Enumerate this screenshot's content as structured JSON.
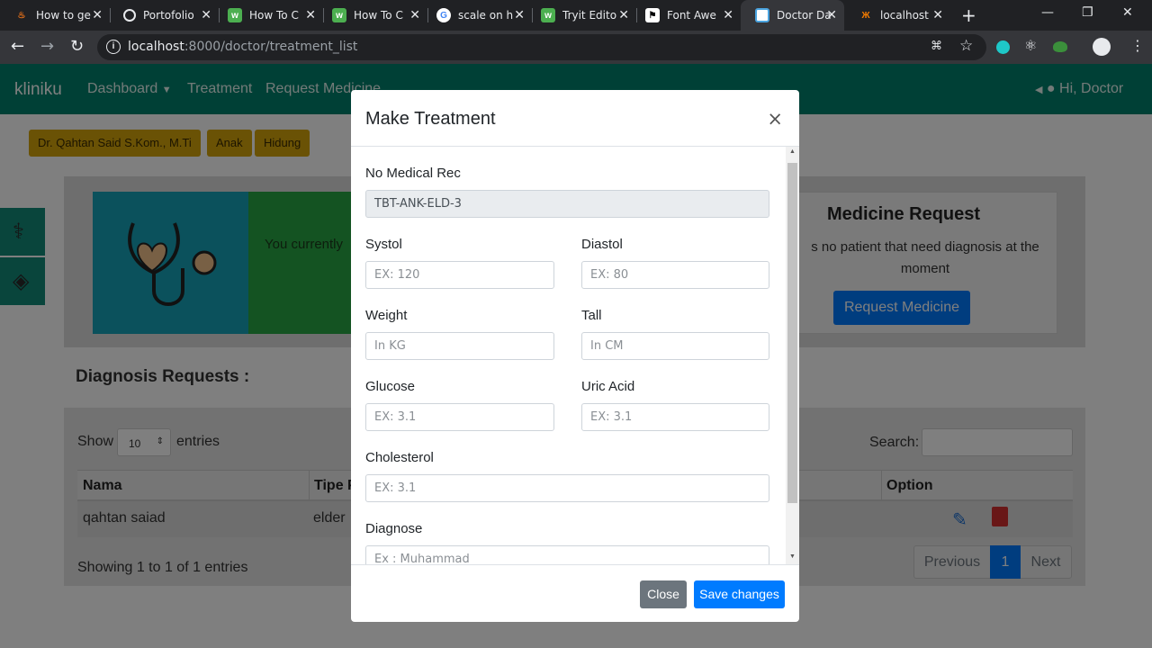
{
  "browser": {
    "tabs": [
      {
        "title": "How to ge",
        "favicon": "fire-favicon",
        "color": "#e8711a"
      },
      {
        "title": "Portofolio",
        "favicon": "globe-favicon",
        "color": "#e8eaed"
      },
      {
        "title": "How To C",
        "favicon": "w3-favicon",
        "color": "#4caf50"
      },
      {
        "title": "How To C",
        "favicon": "w3-favicon",
        "color": "#4caf50"
      },
      {
        "title": "scale on h",
        "favicon": "google-favicon",
        "color": "#e8eaed"
      },
      {
        "title": "Tryit Edito",
        "favicon": "w3-favicon",
        "color": "#4caf50"
      },
      {
        "title": "Font Awe",
        "favicon": "flag-favicon",
        "color": "#ffffff"
      },
      {
        "title": "Doctor Da",
        "favicon": "doc-favicon",
        "color": "#4aa3df"
      },
      {
        "title": "localhost",
        "favicon": "xampp-favicon",
        "color": "#f57c00"
      }
    ],
    "url_host": "localhost",
    "url_path": ":8000/doctor/treatment_list"
  },
  "navbar": {
    "brand": "kliniku",
    "links": [
      "Dashboard",
      "Treatment",
      "Request Medicine"
    ],
    "user": "Hi, Doctor"
  },
  "badges": [
    "Dr. Qahtan Said S.Kom., M.Ti",
    "Anak",
    "Hidung"
  ],
  "cards": {
    "treatment_text": "You currently",
    "medicine_title": "Medicine Request",
    "medicine_text": "s no patient that need diagnosis at the moment",
    "medicine_button": "Request Medicine"
  },
  "diagnosis": {
    "heading": "Diagnosis Requests :",
    "show": "Show",
    "entries_value": "10",
    "entries": "entries",
    "search": "Search:",
    "columns": [
      "Nama",
      "Tipe P",
      "Option"
    ],
    "row": {
      "nama": "qahtan saiad",
      "tipe": "elder"
    },
    "info": "Showing 1 to 1 of 1 entries",
    "pager": [
      "Previous",
      "1",
      "Next"
    ]
  },
  "modal": {
    "title": "Make Treatment",
    "close_x": "×",
    "fields": {
      "medrec_label": "No Medical Rec",
      "medrec_value": "TBT-ANK-ELD-3",
      "systol_label": "Systol",
      "systol_ph": "EX: 120",
      "diastol_label": "Diastol",
      "diastol_ph": "EX: 80",
      "weight_label": "Weight",
      "weight_ph": "In KG",
      "tall_label": "Tall",
      "tall_ph": "In CM",
      "glucose_label": "Glucose",
      "glucose_ph": "EX: 3.1",
      "uric_label": "Uric Acid",
      "uric_ph": "EX: 3.1",
      "chol_label": "Cholesterol",
      "chol_ph": "EX: 3.1",
      "diag_label": "Diagnose",
      "diag_ph": "Ex : Muhammad"
    },
    "close_button": "Close",
    "save_button": "Save changes"
  },
  "colors": {
    "navbar": "#00806c",
    "primary": "#007bff",
    "badge": "#d4a40a",
    "secondary": "#6c757d"
  }
}
